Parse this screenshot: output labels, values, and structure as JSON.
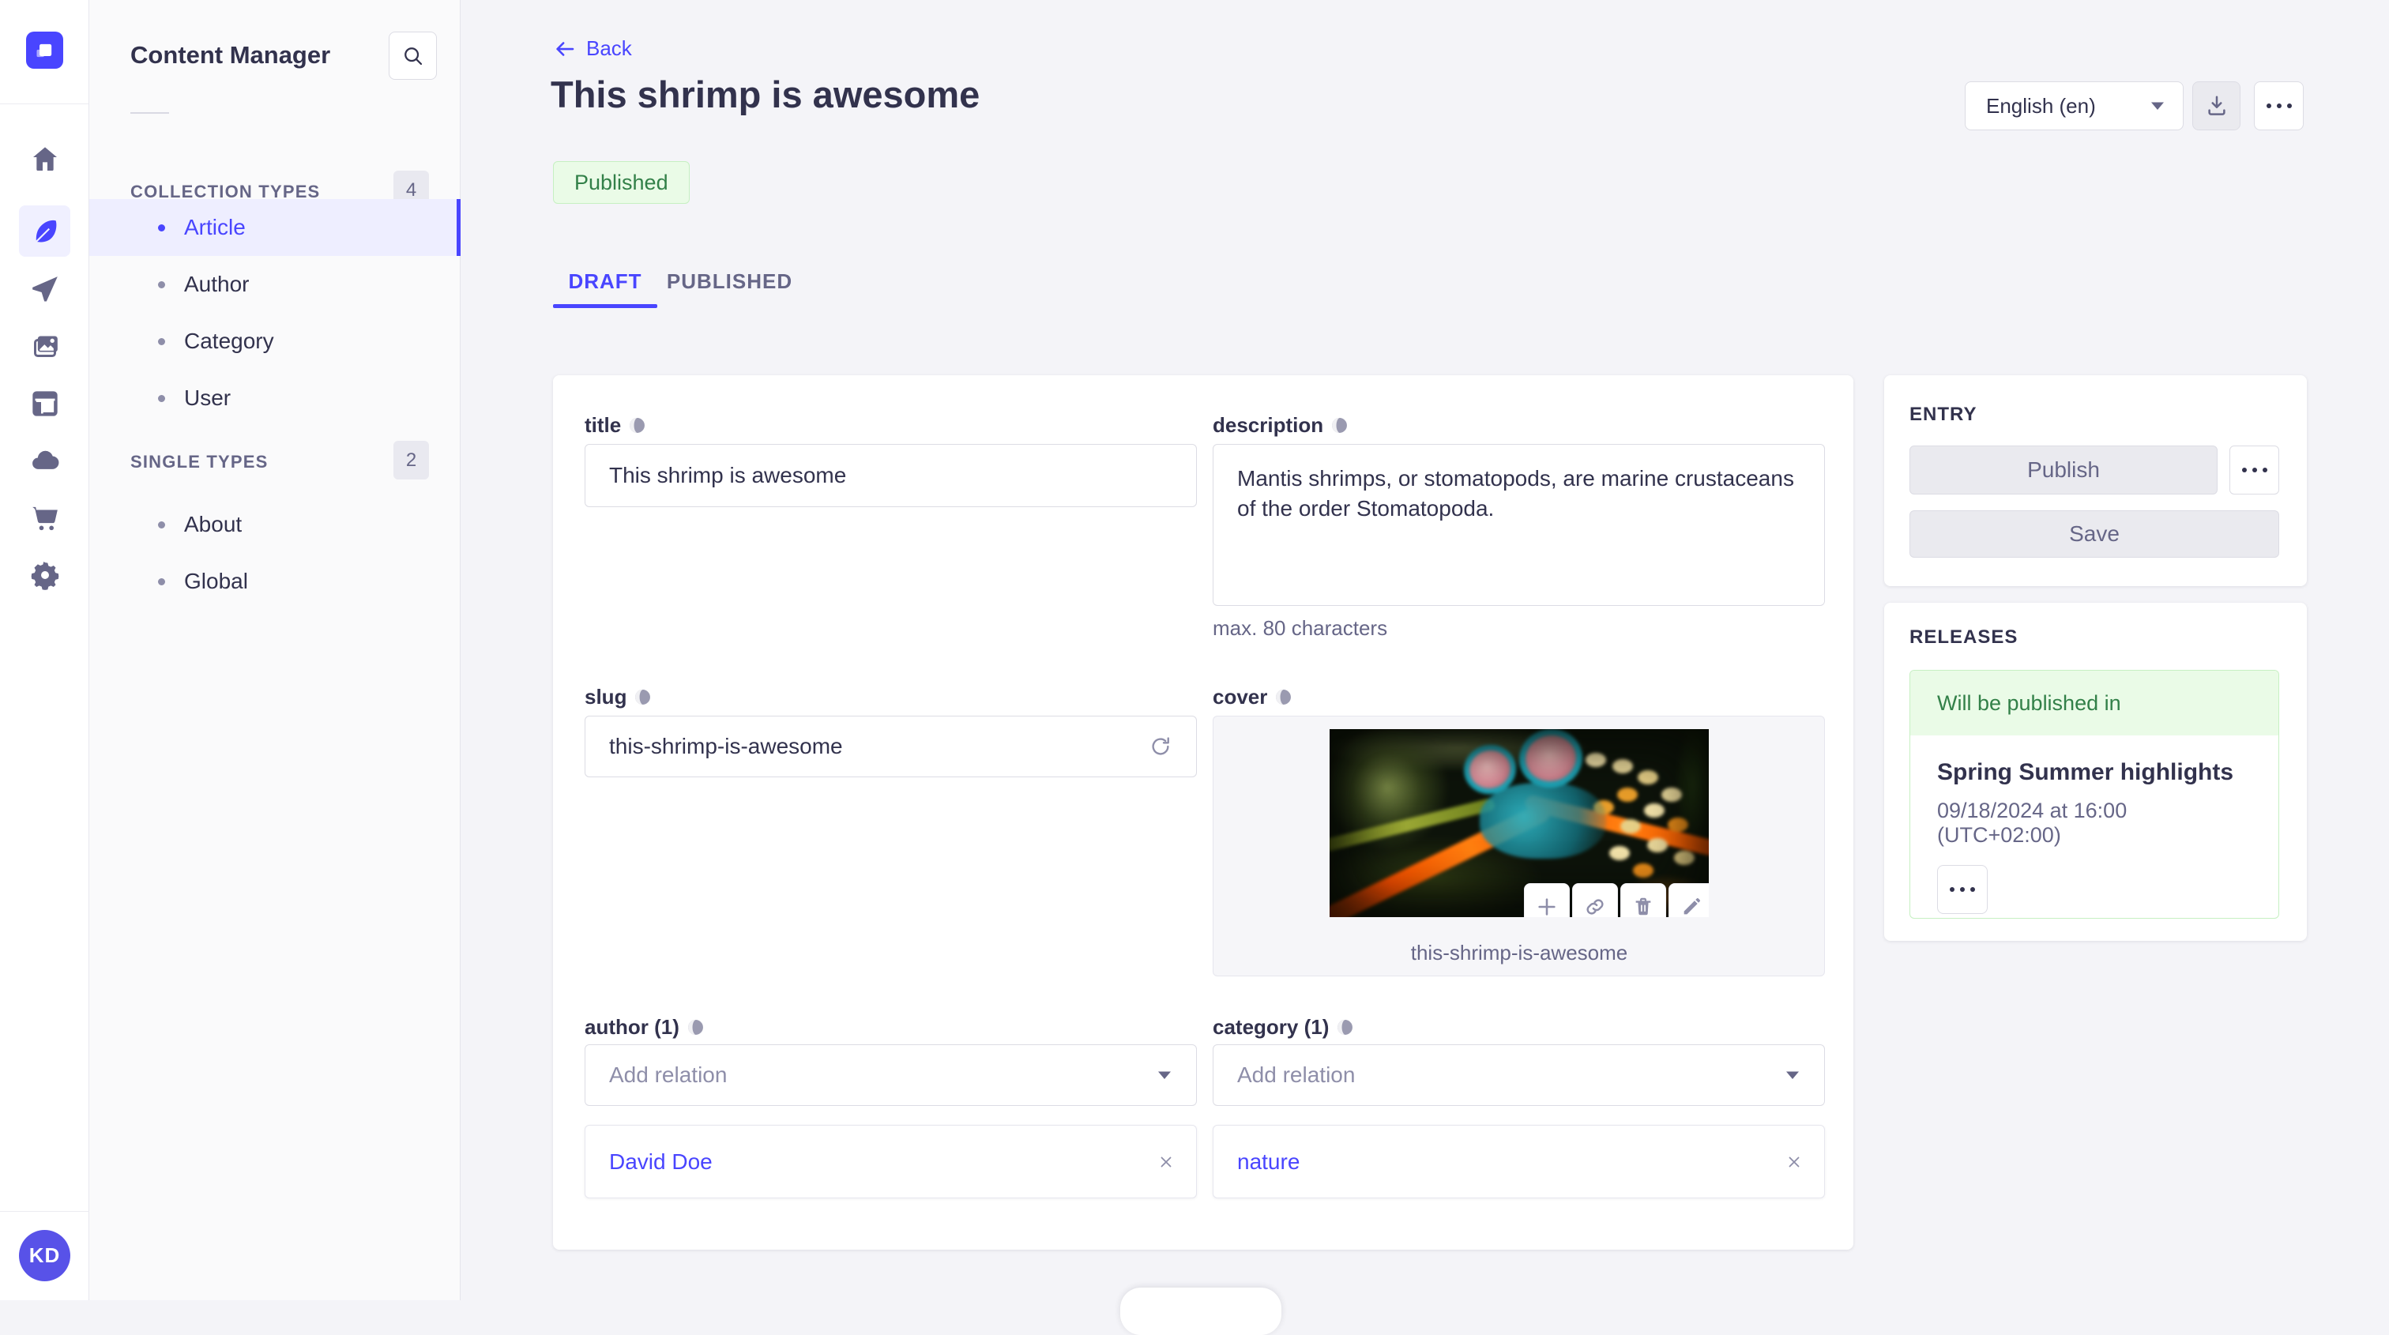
{
  "colors": {
    "accent": "#4945ff",
    "accent_bg": "#f0f0ff",
    "success_text": "#328048",
    "success_bg": "#eafbe7",
    "success_border": "#c6f0c2",
    "text": "#32324d",
    "muted": "#666687"
  },
  "nav_rail": {
    "avatar_initials": "KD"
  },
  "sidebar": {
    "title": "Content Manager",
    "sections": [
      {
        "label": "COLLECTION TYPES",
        "count": "4",
        "items": [
          {
            "label": "Article"
          },
          {
            "label": "Author"
          },
          {
            "label": "Category"
          },
          {
            "label": "User"
          }
        ]
      },
      {
        "label": "SINGLE TYPES",
        "count": "2",
        "items": [
          {
            "label": "About"
          },
          {
            "label": "Global"
          }
        ]
      }
    ]
  },
  "header": {
    "back_label": "Back",
    "title": "This shrimp is awesome",
    "status": "Published",
    "locale": "English (en)"
  },
  "tabs": {
    "draft": "DRAFT",
    "published": "PUBLISHED"
  },
  "form": {
    "title": {
      "label": "title",
      "value": "This shrimp is awesome"
    },
    "description": {
      "label": "description",
      "value": "Mantis shrimps, or stomatopods, are marine crustaceans of the order Stomatopoda.",
      "hint": "max. 80 characters"
    },
    "slug": {
      "label": "slug",
      "value": "this-shrimp-is-awesome"
    },
    "cover": {
      "label": "cover",
      "caption": "this-shrimp-is-awesome"
    },
    "author": {
      "label": "author (1)",
      "placeholder": "Add relation",
      "relations": [
        {
          "label": "David Doe"
        }
      ]
    },
    "category": {
      "label": "category (1)",
      "placeholder": "Add relation",
      "relations": [
        {
          "label": "nature"
        }
      ]
    }
  },
  "entry_panel": {
    "heading": "ENTRY",
    "publish_label": "Publish",
    "save_label": "Save"
  },
  "releases_panel": {
    "heading": "RELEASES",
    "status": "Will be published in",
    "release_name": "Spring Summer highlights",
    "release_date": "09/18/2024 at 16:00 (UTC+02:00)"
  }
}
